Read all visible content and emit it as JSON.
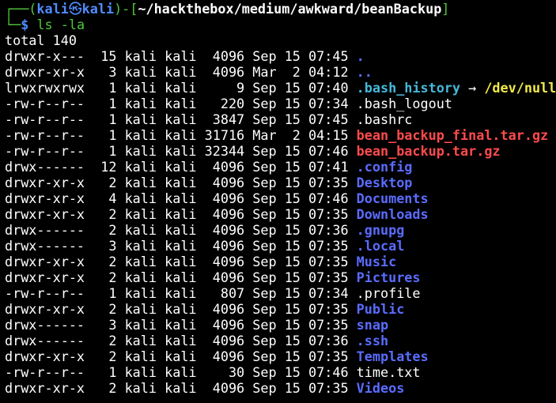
{
  "prompt": {
    "user": "kali",
    "host": "kali",
    "separator_icon": "skull-icon",
    "path": "~/hackthebox/medium/awkward/beanBackup",
    "symbol": "$",
    "command": "ls -la"
  },
  "output": {
    "total": "total 140",
    "entries": [
      {
        "perm": "drwxr-x---",
        "links": "15",
        "owner": "kali",
        "group": "kali",
        "size": "4096",
        "month": "Sep",
        "day": "15",
        "time": "07:45",
        "name": ".",
        "target": "",
        "color": "#5a6cff"
      },
      {
        "perm": "drwxr-xr-x",
        "links": "3",
        "owner": "kali",
        "group": "kali",
        "size": "4096",
        "month": "Mar",
        "day": "2",
        "time": "04:12",
        "name": "..",
        "target": "",
        "color": "#5a6cff"
      },
      {
        "perm": "lrwxrwxrwx",
        "links": "1",
        "owner": "kali",
        "group": "kali",
        "size": "9",
        "month": "Sep",
        "day": "15",
        "time": "07:40",
        "name": ".bash_history",
        "target": "/dev/null",
        "color": "#46b8d9"
      },
      {
        "perm": "-rw-r--r--",
        "links": "1",
        "owner": "kali",
        "group": "kali",
        "size": "220",
        "month": "Sep",
        "day": "15",
        "time": "07:34",
        "name": ".bash_logout",
        "target": "",
        "color": "#ffffff"
      },
      {
        "perm": "-rw-r--r--",
        "links": "1",
        "owner": "kali",
        "group": "kali",
        "size": "3847",
        "month": "Sep",
        "day": "15",
        "time": "07:45",
        "name": ".bashrc",
        "target": "",
        "color": "#ffffff"
      },
      {
        "perm": "-rw-r--r--",
        "links": "1",
        "owner": "kali",
        "group": "kali",
        "size": "31716",
        "month": "Mar",
        "day": "2",
        "time": "04:15",
        "name": "bean_backup_final.tar.gz",
        "target": "",
        "color": "#ff4b4b"
      },
      {
        "perm": "-rw-r--r--",
        "links": "1",
        "owner": "kali",
        "group": "kali",
        "size": "32344",
        "month": "Sep",
        "day": "15",
        "time": "07:46",
        "name": "bean_backup.tar.gz",
        "target": "",
        "color": "#ff4b4b"
      },
      {
        "perm": "drwx------",
        "links": "12",
        "owner": "kali",
        "group": "kali",
        "size": "4096",
        "month": "Sep",
        "day": "15",
        "time": "07:41",
        "name": ".config",
        "target": "",
        "color": "#5a6cff"
      },
      {
        "perm": "drwxr-xr-x",
        "links": "2",
        "owner": "kali",
        "group": "kali",
        "size": "4096",
        "month": "Sep",
        "day": "15",
        "time": "07:35",
        "name": "Desktop",
        "target": "",
        "color": "#5a6cff"
      },
      {
        "perm": "drwxr-xr-x",
        "links": "4",
        "owner": "kali",
        "group": "kali",
        "size": "4096",
        "month": "Sep",
        "day": "15",
        "time": "07:46",
        "name": "Documents",
        "target": "",
        "color": "#5a6cff"
      },
      {
        "perm": "drwxr-xr-x",
        "links": "2",
        "owner": "kali",
        "group": "kali",
        "size": "4096",
        "month": "Sep",
        "day": "15",
        "time": "07:35",
        "name": "Downloads",
        "target": "",
        "color": "#5a6cff"
      },
      {
        "perm": "drwx------",
        "links": "2",
        "owner": "kali",
        "group": "kali",
        "size": "4096",
        "month": "Sep",
        "day": "15",
        "time": "07:36",
        "name": ".gnupg",
        "target": "",
        "color": "#5a6cff"
      },
      {
        "perm": "drwx------",
        "links": "3",
        "owner": "kali",
        "group": "kali",
        "size": "4096",
        "month": "Sep",
        "day": "15",
        "time": "07:35",
        "name": ".local",
        "target": "",
        "color": "#5a6cff"
      },
      {
        "perm": "drwxr-xr-x",
        "links": "2",
        "owner": "kali",
        "group": "kali",
        "size": "4096",
        "month": "Sep",
        "day": "15",
        "time": "07:35",
        "name": "Music",
        "target": "",
        "color": "#5a6cff"
      },
      {
        "perm": "drwxr-xr-x",
        "links": "2",
        "owner": "kali",
        "group": "kali",
        "size": "4096",
        "month": "Sep",
        "day": "15",
        "time": "07:35",
        "name": "Pictures",
        "target": "",
        "color": "#5a6cff"
      },
      {
        "perm": "-rw-r--r--",
        "links": "1",
        "owner": "kali",
        "group": "kali",
        "size": "807",
        "month": "Sep",
        "day": "15",
        "time": "07:34",
        "name": ".profile",
        "target": "",
        "color": "#ffffff"
      },
      {
        "perm": "drwxr-xr-x",
        "links": "2",
        "owner": "kali",
        "group": "kali",
        "size": "4096",
        "month": "Sep",
        "day": "15",
        "time": "07:35",
        "name": "Public",
        "target": "",
        "color": "#5a6cff"
      },
      {
        "perm": "drwx------",
        "links": "3",
        "owner": "kali",
        "group": "kali",
        "size": "4096",
        "month": "Sep",
        "day": "15",
        "time": "07:35",
        "name": "snap",
        "target": "",
        "color": "#5a6cff"
      },
      {
        "perm": "drwx------",
        "links": "2",
        "owner": "kali",
        "group": "kali",
        "size": "4096",
        "month": "Sep",
        "day": "15",
        "time": "07:36",
        "name": ".ssh",
        "target": "",
        "color": "#5a6cff"
      },
      {
        "perm": "drwxr-xr-x",
        "links": "2",
        "owner": "kali",
        "group": "kali",
        "size": "4096",
        "month": "Sep",
        "day": "15",
        "time": "07:35",
        "name": "Templates",
        "target": "",
        "color": "#5a6cff"
      },
      {
        "perm": "-rw-r--r--",
        "links": "1",
        "owner": "kali",
        "group": "kali",
        "size": "30",
        "month": "Sep",
        "day": "15",
        "time": "07:46",
        "name": "time.txt",
        "target": "",
        "color": "#ffffff"
      },
      {
        "perm": "drwxr-xr-x",
        "links": "2",
        "owner": "kali",
        "group": "kali",
        "size": "4096",
        "month": "Sep",
        "day": "15",
        "time": "07:35",
        "name": "Videos",
        "target": "",
        "color": "#5a6cff"
      }
    ]
  },
  "colors": {
    "prompt_frame": "#4fc63b",
    "prompt_user": "#4f8cff",
    "directory": "#5a6cff",
    "symlink": "#46b8d9",
    "archive": "#ff4b4b",
    "symlink_target": "#f1e94a",
    "background": "#000000"
  }
}
